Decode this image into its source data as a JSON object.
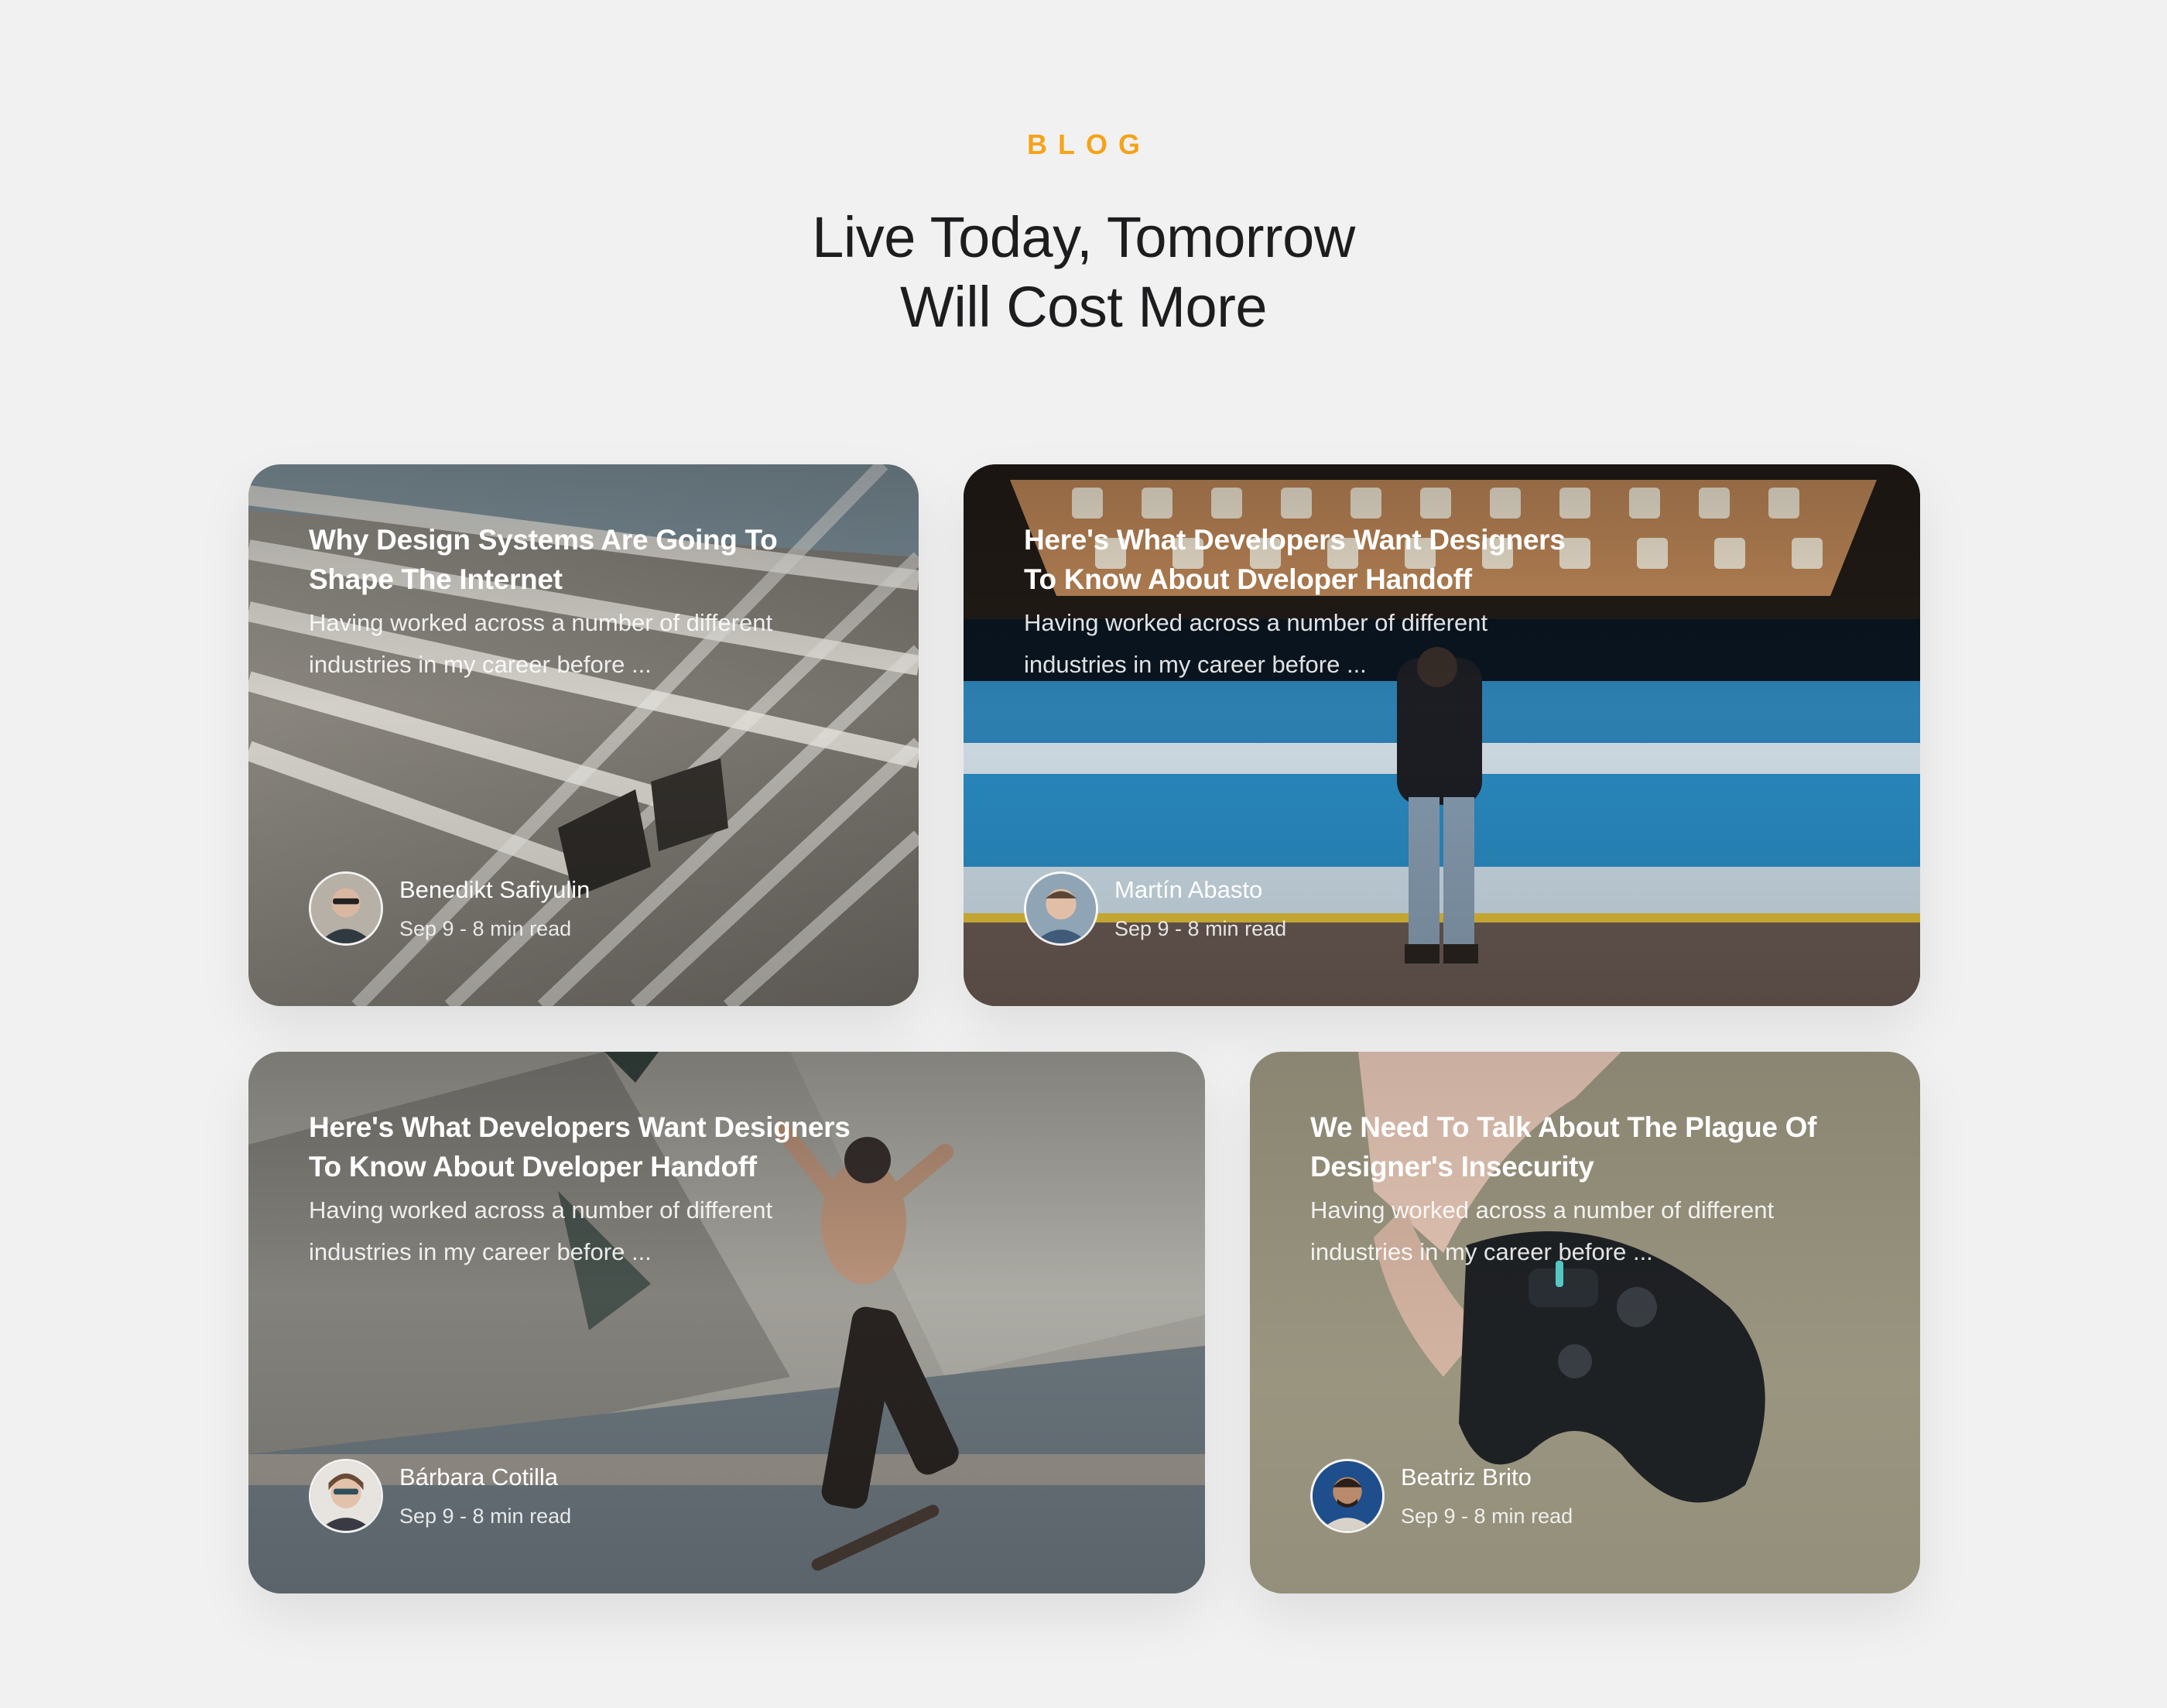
{
  "section": {
    "eyebrow": "BLOG",
    "headline_line1": "Live Today, Tomorrow",
    "headline_line2": "Will Cost More"
  },
  "colors": {
    "accent": "#f5a31a",
    "background": "#f1f1f1",
    "heading": "#1d1d1f"
  },
  "posts": [
    {
      "title": "Why Design Systems Are Going To Shape The Internet",
      "excerpt": "Having worked across a number of different industries in my career before ...",
      "author": "Benedikt Safiyulin",
      "meta": "Sep 9 - 8 min read",
      "image": "architecture-slats-photo"
    },
    {
      "title": "Here's What Developers Want Designers To Know About Dveloper Handoff",
      "excerpt": "Having worked across a number of different industries in my career before ...",
      "author": "Martín Abasto",
      "meta": "Sep 9 - 8 min read",
      "image": "subway-platform-photo"
    },
    {
      "title": "Here's What Developers Want Designers To Know About Dveloper Handoff",
      "excerpt": "Having worked across a number of different industries in my career before ...",
      "author": "Bárbara Cotilla",
      "meta": "Sep 9 - 8 min read",
      "image": "skateboarder-photo"
    },
    {
      "title": "We Need To Talk About The Plague Of Designer's Insecurity",
      "excerpt": "Having worked across a number of different industries in my career before ...",
      "author": "Beatriz Brito",
      "meta": "Sep 9 - 8 min read",
      "image": "game-controller-photo"
    }
  ]
}
